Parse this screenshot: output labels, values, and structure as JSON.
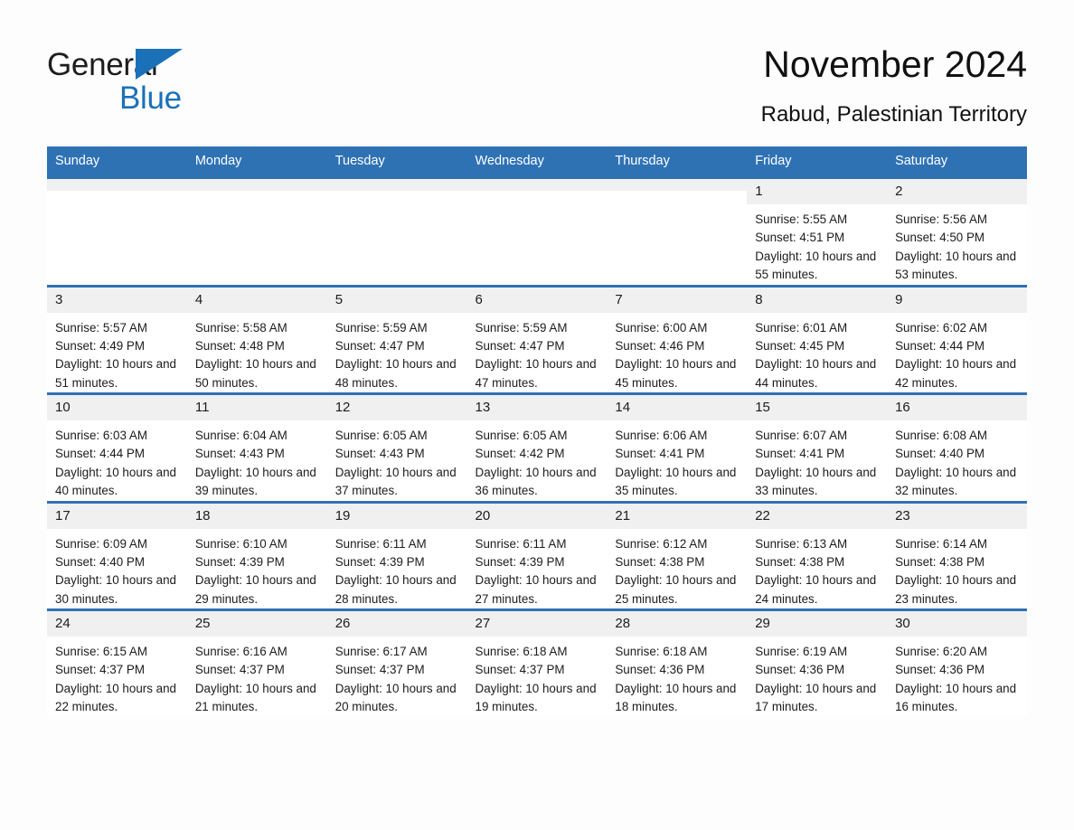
{
  "brand": {
    "name_part1": "General",
    "name_part2": "Blue",
    "logo_icon": "triangle-flag-icon",
    "accent_color": "#1b71b8"
  },
  "header": {
    "title": "November 2024",
    "subtitle": "Rabud, Palestinian Territory"
  },
  "theme": {
    "header_blue": "#2f72b4",
    "daynum_band": "#f0f0f0",
    "page_bg": "#fdfdfd"
  },
  "weekdays": [
    "Sunday",
    "Monday",
    "Tuesday",
    "Wednesday",
    "Thursday",
    "Friday",
    "Saturday"
  ],
  "weeks": [
    [
      {
        "day": "",
        "lines": []
      },
      {
        "day": "",
        "lines": []
      },
      {
        "day": "",
        "lines": []
      },
      {
        "day": "",
        "lines": []
      },
      {
        "day": "",
        "lines": []
      },
      {
        "day": "1",
        "lines": [
          "Sunrise: 5:55 AM",
          "Sunset: 4:51 PM",
          "Daylight: 10 hours and 55 minutes."
        ]
      },
      {
        "day": "2",
        "lines": [
          "Sunrise: 5:56 AM",
          "Sunset: 4:50 PM",
          "Daylight: 10 hours and 53 minutes."
        ]
      }
    ],
    [
      {
        "day": "3",
        "lines": [
          "Sunrise: 5:57 AM",
          "Sunset: 4:49 PM",
          "Daylight: 10 hours and 51 minutes."
        ]
      },
      {
        "day": "4",
        "lines": [
          "Sunrise: 5:58 AM",
          "Sunset: 4:48 PM",
          "Daylight: 10 hours and 50 minutes."
        ]
      },
      {
        "day": "5",
        "lines": [
          "Sunrise: 5:59 AM",
          "Sunset: 4:47 PM",
          "Daylight: 10 hours and 48 minutes."
        ]
      },
      {
        "day": "6",
        "lines": [
          "Sunrise: 5:59 AM",
          "Sunset: 4:47 PM",
          "Daylight: 10 hours and 47 minutes."
        ]
      },
      {
        "day": "7",
        "lines": [
          "Sunrise: 6:00 AM",
          "Sunset: 4:46 PM",
          "Daylight: 10 hours and 45 minutes."
        ]
      },
      {
        "day": "8",
        "lines": [
          "Sunrise: 6:01 AM",
          "Sunset: 4:45 PM",
          "Daylight: 10 hours and 44 minutes."
        ]
      },
      {
        "day": "9",
        "lines": [
          "Sunrise: 6:02 AM",
          "Sunset: 4:44 PM",
          "Daylight: 10 hours and 42 minutes."
        ]
      }
    ],
    [
      {
        "day": "10",
        "lines": [
          "Sunrise: 6:03 AM",
          "Sunset: 4:44 PM",
          "Daylight: 10 hours and 40 minutes."
        ]
      },
      {
        "day": "11",
        "lines": [
          "Sunrise: 6:04 AM",
          "Sunset: 4:43 PM",
          "Daylight: 10 hours and 39 minutes."
        ]
      },
      {
        "day": "12",
        "lines": [
          "Sunrise: 6:05 AM",
          "Sunset: 4:43 PM",
          "Daylight: 10 hours and 37 minutes."
        ]
      },
      {
        "day": "13",
        "lines": [
          "Sunrise: 6:05 AM",
          "Sunset: 4:42 PM",
          "Daylight: 10 hours and 36 minutes."
        ]
      },
      {
        "day": "14",
        "lines": [
          "Sunrise: 6:06 AM",
          "Sunset: 4:41 PM",
          "Daylight: 10 hours and 35 minutes."
        ]
      },
      {
        "day": "15",
        "lines": [
          "Sunrise: 6:07 AM",
          "Sunset: 4:41 PM",
          "Daylight: 10 hours and 33 minutes."
        ]
      },
      {
        "day": "16",
        "lines": [
          "Sunrise: 6:08 AM",
          "Sunset: 4:40 PM",
          "Daylight: 10 hours and 32 minutes."
        ]
      }
    ],
    [
      {
        "day": "17",
        "lines": [
          "Sunrise: 6:09 AM",
          "Sunset: 4:40 PM",
          "Daylight: 10 hours and 30 minutes."
        ]
      },
      {
        "day": "18",
        "lines": [
          "Sunrise: 6:10 AM",
          "Sunset: 4:39 PM",
          "Daylight: 10 hours and 29 minutes."
        ]
      },
      {
        "day": "19",
        "lines": [
          "Sunrise: 6:11 AM",
          "Sunset: 4:39 PM",
          "Daylight: 10 hours and 28 minutes."
        ]
      },
      {
        "day": "20",
        "lines": [
          "Sunrise: 6:11 AM",
          "Sunset: 4:39 PM",
          "Daylight: 10 hours and 27 minutes."
        ]
      },
      {
        "day": "21",
        "lines": [
          "Sunrise: 6:12 AM",
          "Sunset: 4:38 PM",
          "Daylight: 10 hours and 25 minutes."
        ]
      },
      {
        "day": "22",
        "lines": [
          "Sunrise: 6:13 AM",
          "Sunset: 4:38 PM",
          "Daylight: 10 hours and 24 minutes."
        ]
      },
      {
        "day": "23",
        "lines": [
          "Sunrise: 6:14 AM",
          "Sunset: 4:38 PM",
          "Daylight: 10 hours and 23 minutes."
        ]
      }
    ],
    [
      {
        "day": "24",
        "lines": [
          "Sunrise: 6:15 AM",
          "Sunset: 4:37 PM",
          "Daylight: 10 hours and 22 minutes."
        ]
      },
      {
        "day": "25",
        "lines": [
          "Sunrise: 6:16 AM",
          "Sunset: 4:37 PM",
          "Daylight: 10 hours and 21 minutes."
        ]
      },
      {
        "day": "26",
        "lines": [
          "Sunrise: 6:17 AM",
          "Sunset: 4:37 PM",
          "Daylight: 10 hours and 20 minutes."
        ]
      },
      {
        "day": "27",
        "lines": [
          "Sunrise: 6:18 AM",
          "Sunset: 4:37 PM",
          "Daylight: 10 hours and 19 minutes."
        ]
      },
      {
        "day": "28",
        "lines": [
          "Sunrise: 6:18 AM",
          "Sunset: 4:36 PM",
          "Daylight: 10 hours and 18 minutes."
        ]
      },
      {
        "day": "29",
        "lines": [
          "Sunrise: 6:19 AM",
          "Sunset: 4:36 PM",
          "Daylight: 10 hours and 17 minutes."
        ]
      },
      {
        "day": "30",
        "lines": [
          "Sunrise: 6:20 AM",
          "Sunset: 4:36 PM",
          "Daylight: 10 hours and 16 minutes."
        ]
      }
    ]
  ]
}
